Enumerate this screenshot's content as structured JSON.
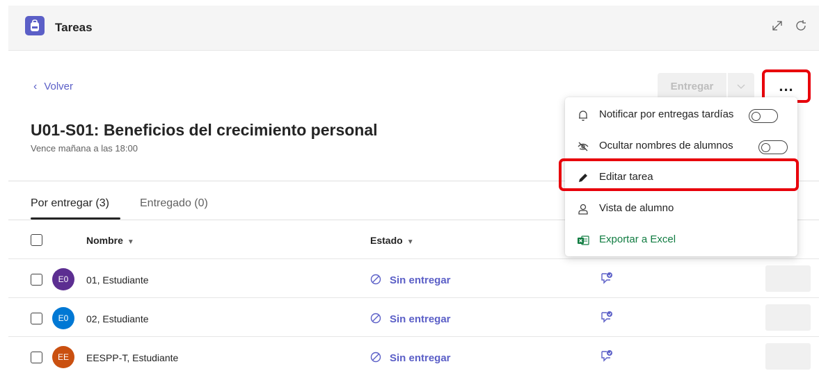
{
  "header": {
    "app_title": "Tareas",
    "icons": [
      "backpack-icon",
      "expand-icon",
      "refresh-icon"
    ]
  },
  "nav": {
    "back_label": "Volver"
  },
  "toolbar": {
    "submit_label": "Entregar",
    "more_label": "..."
  },
  "assignment": {
    "title": "U01-S01: Beneficios del crecimiento personal",
    "due": "Vence mañana a las 18:00"
  },
  "tabs": [
    {
      "label": "Por entregar (3)",
      "active": true
    },
    {
      "label": "Entregado (0)",
      "active": false
    }
  ],
  "table": {
    "columns": {
      "name": "Nombre",
      "status": "Estado"
    },
    "rows": [
      {
        "initials": "E0",
        "name": "01, Estudiante",
        "status": "Sin entregar",
        "avatar_color": "#5c2e91"
      },
      {
        "initials": "E0",
        "name": "02, Estudiante",
        "status": "Sin entregar",
        "avatar_color": "#0078d4"
      },
      {
        "initials": "EE",
        "name": "EESPP-T, Estudiante",
        "status": "Sin entregar",
        "avatar_color": "#ca5010"
      }
    ]
  },
  "menu": {
    "items": [
      {
        "label": "Notificar por entregas tardías",
        "icon": "bell-icon",
        "toggle": false
      },
      {
        "label": "Ocultar nombres de alumnos",
        "icon": "eye-off-icon",
        "toggle": false
      },
      {
        "label": "Editar tarea",
        "icon": "pencil-icon"
      },
      {
        "label": "Vista de alumno",
        "icon": "person-icon"
      },
      {
        "label": "Exportar a Excel",
        "icon": "excel-icon",
        "color": "#107c41"
      }
    ]
  },
  "colors": {
    "accent": "#5b5fc7",
    "highlight": "#e8000b",
    "excel": "#107c41"
  }
}
